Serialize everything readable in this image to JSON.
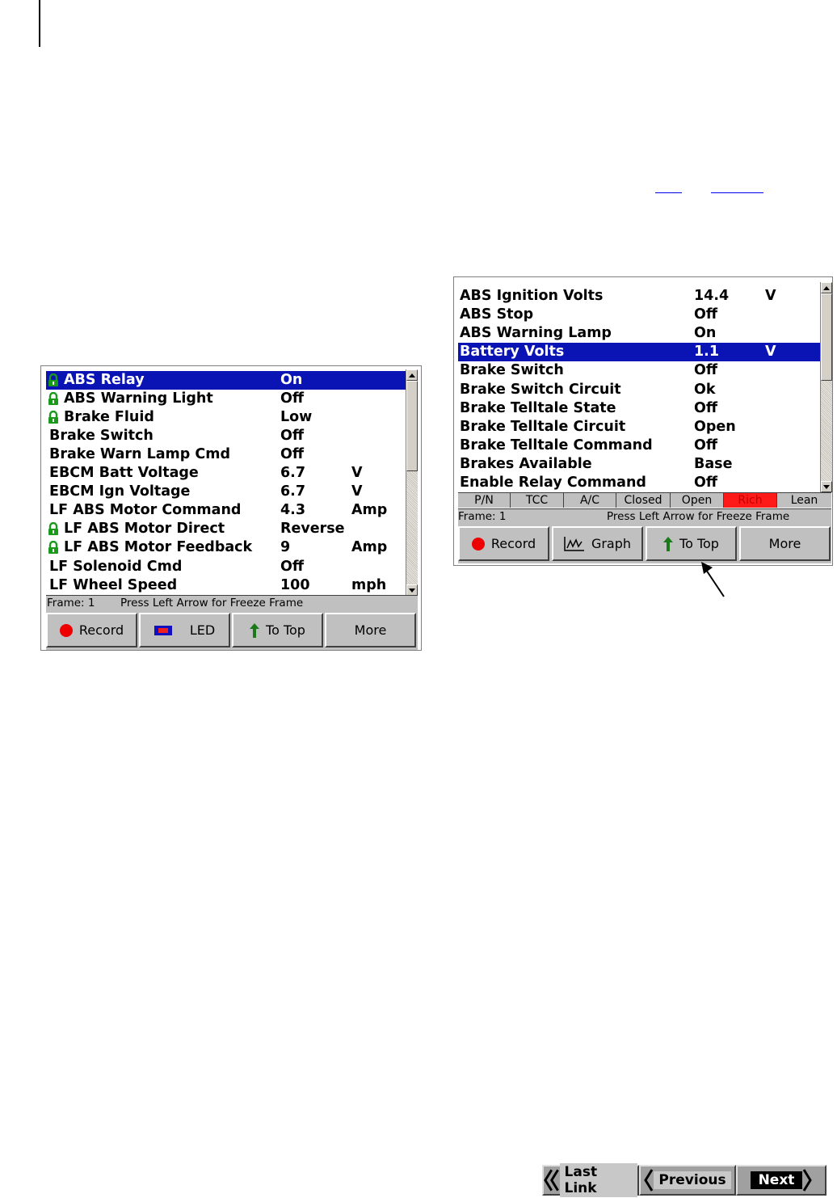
{
  "screen_left": {
    "rows": [
      {
        "name": "ABS Relay",
        "value": "On",
        "unit": "",
        "locked": true,
        "selected": true
      },
      {
        "name": "ABS Warning Light",
        "value": "Off",
        "unit": "",
        "locked": true,
        "selected": false
      },
      {
        "name": "Brake Fluid",
        "value": "Low",
        "unit": "",
        "locked": true,
        "selected": false
      },
      {
        "name": "Brake Switch",
        "value": "Off",
        "unit": "",
        "locked": false,
        "selected": false
      },
      {
        "name": "Brake Warn Lamp Cmd",
        "value": "Off",
        "unit": "",
        "locked": false,
        "selected": false
      },
      {
        "name": "EBCM Batt Voltage",
        "value": "6.7",
        "unit": "V",
        "locked": false,
        "selected": false
      },
      {
        "name": "EBCM Ign Voltage",
        "value": "6.7",
        "unit": "V",
        "locked": false,
        "selected": false
      },
      {
        "name": "LF ABS Motor Command",
        "value": "4.3",
        "unit": "Amp",
        "locked": false,
        "selected": false
      },
      {
        "name": "LF ABS Motor Direct",
        "value": "Reverse",
        "unit": "",
        "locked": true,
        "selected": false
      },
      {
        "name": "LF ABS Motor Feedback",
        "value": "9",
        "unit": "Amp",
        "locked": true,
        "selected": false
      },
      {
        "name": "LF Solenoid Cmd",
        "value": "Off",
        "unit": "",
        "locked": false,
        "selected": false
      },
      {
        "name": "LF Wheel Speed",
        "value": "100",
        "unit": "mph",
        "locked": false,
        "selected": false
      }
    ],
    "status": {
      "frame": "Frame: 1",
      "hint": "Press Left Arrow for Freeze Frame"
    },
    "buttons": {
      "record": "Record",
      "led": "LED",
      "to_top": "To Top",
      "more": "More"
    }
  },
  "screen_right": {
    "rows": [
      {
        "name": "ABS Ignition Volts",
        "value": "14.4",
        "unit": "V",
        "selected": false
      },
      {
        "name": "ABS Stop",
        "value": "Off",
        "unit": "",
        "selected": false
      },
      {
        "name": "ABS Warning Lamp",
        "value": "On",
        "unit": "",
        "selected": false
      },
      {
        "name": "Battery Volts",
        "value": "1.1",
        "unit": "V",
        "selected": true
      },
      {
        "name": "Brake Switch",
        "value": "Off",
        "unit": "",
        "selected": false
      },
      {
        "name": "Brake Switch Circuit",
        "value": "Ok",
        "unit": "",
        "selected": false
      },
      {
        "name": "Brake Telltale State",
        "value": "Off",
        "unit": "",
        "selected": false
      },
      {
        "name": "Brake Telltale Circuit",
        "value": "Open",
        "unit": "",
        "selected": false
      },
      {
        "name": "Brake Telltale Command",
        "value": "Off",
        "unit": "",
        "selected": false
      },
      {
        "name": "Brakes Available",
        "value": "Base",
        "unit": "",
        "selected": false
      },
      {
        "name": "Enable Relay Command",
        "value": "Off",
        "unit": "",
        "selected": false
      }
    ],
    "indicators": [
      {
        "label": "P/N",
        "active": false
      },
      {
        "label": "TCC",
        "active": false
      },
      {
        "label": "A/C",
        "active": false
      },
      {
        "label": "Closed",
        "active": false
      },
      {
        "label": "Open",
        "active": false
      },
      {
        "label": "Rich",
        "active": true
      },
      {
        "label": "Lean",
        "active": false
      }
    ],
    "status": {
      "frame": "Frame: 1",
      "hint": "Press Left Arrow for Freeze Frame"
    },
    "buttons": {
      "record": "Record",
      "graph": "Graph",
      "to_top": "To Top",
      "more": "More"
    }
  },
  "nav": {
    "last_link": "Last Link",
    "previous": "Previous",
    "next": "Next"
  },
  "colors": {
    "selection": "#0a14b4",
    "lock_icon": "#1a9a1a",
    "record_dot": "#ee0000",
    "active_indicator": "#ff1a1a",
    "arrow_green": "#1a7a1a"
  }
}
